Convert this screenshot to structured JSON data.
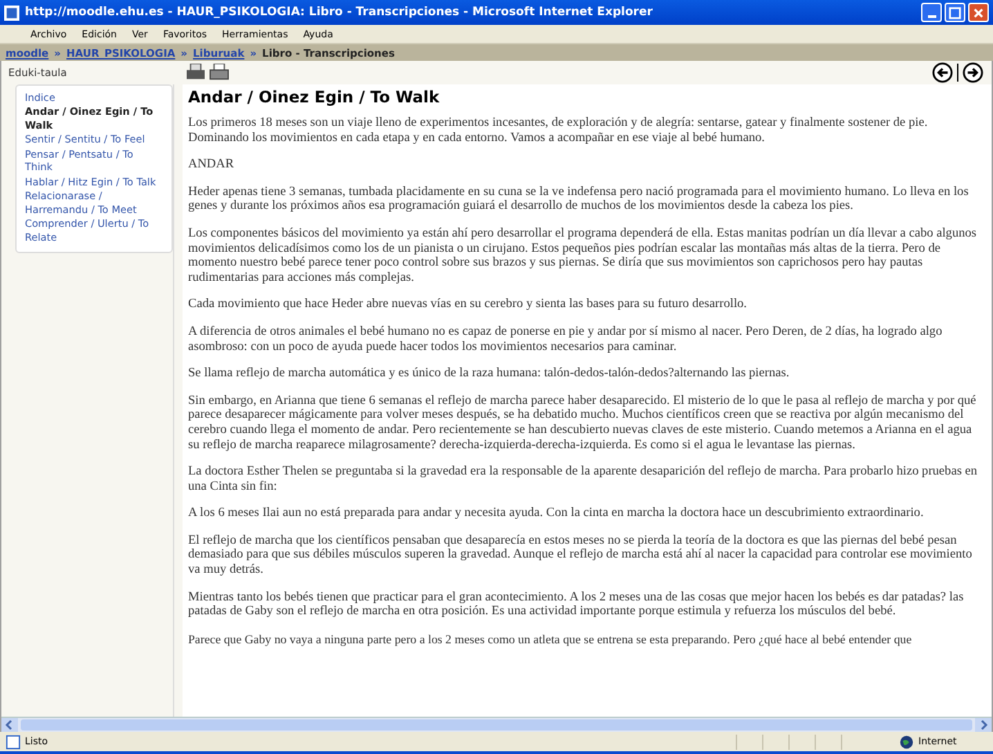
{
  "window": {
    "title": "http://moodle.ehu.es - HAUR_PSIKOLOGIA: Libro - Transcripciones - Microsoft Internet Explorer"
  },
  "menu": [
    "Archivo",
    "Edición",
    "Ver",
    "Favoritos",
    "Herramientas",
    "Ayuda"
  ],
  "breadcrumb": [
    {
      "label": "moodle",
      "kind": "link"
    },
    {
      "label": "»",
      "kind": "separator"
    },
    {
      "label": "HAUR_PSIKOLOGIA",
      "kind": "link"
    },
    {
      "label": "»",
      "kind": "separator"
    },
    {
      "label": "Liburuak",
      "kind": "link"
    },
    {
      "label": "»",
      "kind": "separator"
    },
    {
      "label": "Libro - Transcripciones",
      "kind": "current"
    }
  ],
  "sidebar": {
    "title": "Eduki-taula",
    "items": [
      {
        "label": "Indice",
        "selected": false
      },
      {
        "label": "Andar / Oinez Egin / To Walk",
        "selected": true
      },
      {
        "label": "Sentir / Sentitu / To Feel",
        "selected": false
      },
      {
        "label": "Pensar / Pentsatu / To Think",
        "selected": false
      },
      {
        "label": "Hablar / Hitz Egin / To Talk",
        "selected": false
      },
      {
        "label": "Relacionarase / Harremandu / To Meet",
        "selected": false
      },
      {
        "label": "Comprender / Ulertu / To Relate",
        "selected": false
      }
    ]
  },
  "content": {
    "heading": "Andar / Oinez Egin / To Walk",
    "paragraphs": [
      "Los primeros 18 meses son un viaje lleno de experimentos incesantes, de exploración y de alegría: sentarse, gatear y finalmente sostener de pie. Dominando los movimientos en cada etapa y en cada entorno. Vamos a acompañar en ese viaje al bebé humano.",
      "ANDAR",
      "Heder apenas tiene 3 semanas, tumbada placidamente en su cuna se la ve indefensa pero nació programada para el movimiento humano. Lo lleva en los genes y durante los próximos años esa programación guiará el desarrollo de muchos de los movimientos desde la cabeza los pies.",
      "Los componentes básicos del movimiento ya están ahí pero desarrollar el programa dependerá de ella. Estas manitas podrían un día llevar a cabo algunos movimientos delicadísimos como los de un pianista o un cirujano. Estos pequeños pies podrían escalar las montañas más altas de la tierra. Pero de momento nuestro bebé parece tener poco control sobre sus brazos y sus piernas. Se diría que sus movimientos son caprichosos pero hay pautas rudimentarias para acciones más complejas.",
      "Cada movimiento que hace Heder abre nuevas vías en su cerebro y sienta las bases para su futuro desarrollo.",
      "A diferencia de otros animales el bebé humano no es capaz de ponerse en pie y andar por sí mismo al nacer. Pero Deren, de 2 días, ha logrado algo asombroso: con un poco de ayuda puede hacer todos los movimientos necesarios para caminar.",
      "Se llama reflejo de marcha automática y es único de la raza humana: talón-dedos-talón-dedos?alternando las piernas.",
      "Sin embargo, en Arianna que tiene 6 semanas el reflejo de marcha parece haber desaparecido. El misterio de lo que le pasa al reflejo de marcha y por qué parece desaparecer mágicamente para volver meses después, se ha debatido mucho. Muchos científicos creen que se reactiva por algún mecanismo del cerebro cuando llega el momento de andar. Pero recientemente se han descubierto nuevas claves de este misterio. Cuando metemos a Arianna en el agua su reflejo de marcha reaparece milagrosamente? derecha-izquierda-derecha-izquierda. Es como si el agua le levantase las piernas.",
      "La doctora Esther Thelen se preguntaba si la gravedad era la responsable de la aparente desaparición del reflejo de marcha. Para probarlo hizo pruebas en una Cinta sin fin:",
      "A los 6 meses Ilai aun no está preparada para andar y necesita ayuda. Con la cinta en marcha la doctora hace un descubrimiento extraordinario.",
      "El reflejo de marcha que los científicos pensaban que desaparecía en estos meses no se pierda la teoría de la doctora es que las piernas del bebé pesan demasiado para que sus débiles músculos superen la gravedad. Aunque el reflejo de marcha está ahí al nacer la capacidad para controlar ese movimiento va muy detrás.",
      "Mientras tanto los bebés tienen que practicar para el gran acontecimiento. A los 2 meses una de las cosas que mejor hacen los bebés es dar patadas? las patadas de Gaby son el reflejo de marcha en otra posición. Es una actividad importante porque estimula y refuerza los músculos del bebé.",
      "Parece que Gaby no vaya a ninguna parte pero a los 2 meses como un atleta que se entrena se esta preparando. Pero ¿qué hace al bebé entender que"
    ]
  },
  "status_bar": {
    "text": "Listo",
    "zone": "Internet"
  }
}
